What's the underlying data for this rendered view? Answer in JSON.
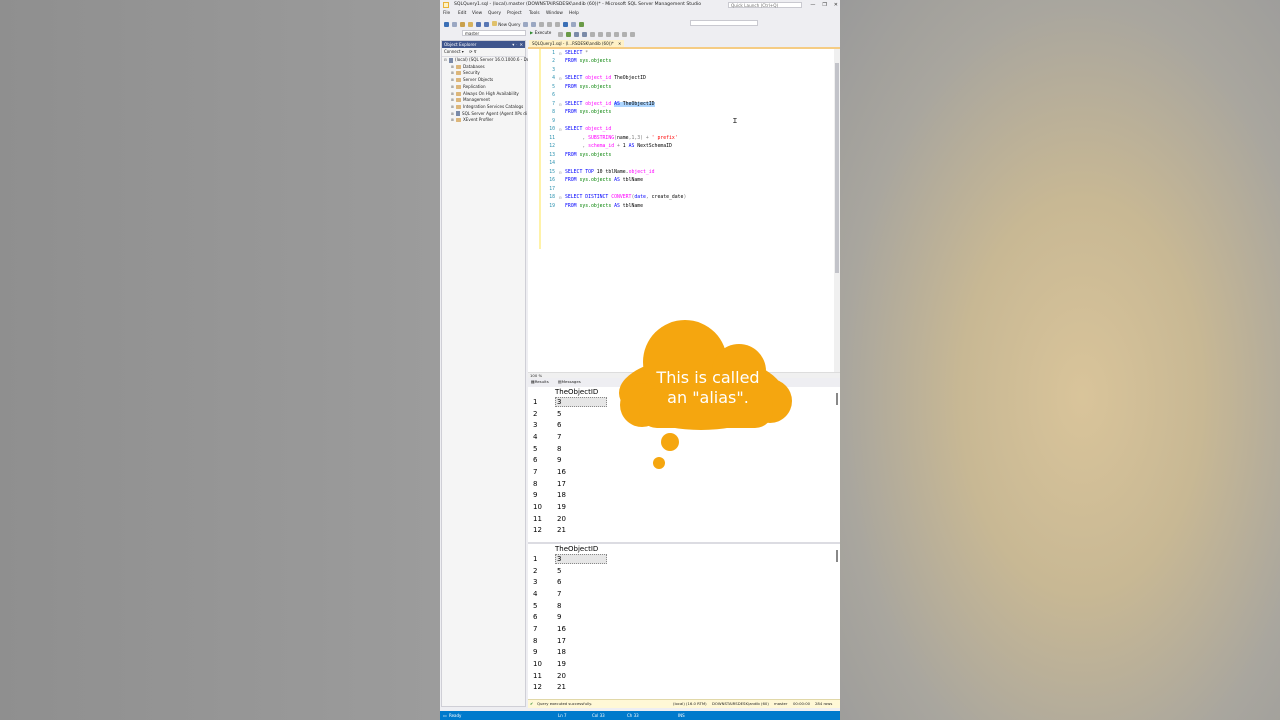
{
  "app": {
    "title": "SQLQuery1.sql - (local).master (DOWNSTAIRSDESK\\andib (60))* - Microsoft SQL Server Management Studio",
    "quick_launch_placeholder": "Quick Launch (Ctrl+Q)",
    "window_buttons": [
      "—",
      "❐",
      "✕"
    ]
  },
  "menu": [
    "File",
    "Edit",
    "View",
    "Query",
    "Project",
    "Tools",
    "Window",
    "Help"
  ],
  "toolbar": {
    "new_query": "New Query",
    "database": "master",
    "execute": "Execute"
  },
  "object_explorer": {
    "header": "Object Explorer",
    "pins": "▾ ᛫ ✕",
    "connect": "Connect ▾",
    "tree": [
      {
        "label": "(local) (SQL Server 16.0.1000.6 - Downsta",
        "type": "server",
        "expanded": true
      },
      {
        "label": "Databases",
        "type": "folder"
      },
      {
        "label": "Security",
        "type": "folder"
      },
      {
        "label": "Server Objects",
        "type": "folder"
      },
      {
        "label": "Replication",
        "type": "folder"
      },
      {
        "label": "Always On High Availability",
        "type": "folder"
      },
      {
        "label": "Management",
        "type": "folder"
      },
      {
        "label": "Integration Services Catalogs",
        "type": "folder"
      },
      {
        "label": "SQL Server Agent (Agent XPs di",
        "type": "agent"
      },
      {
        "label": "XEvent Profiler",
        "type": "folder"
      }
    ]
  },
  "editor": {
    "tab_label": "SQLQuery1.sql - (l...RSDESK\\andib (60))*",
    "tab_close": "✕",
    "zoom": "100 %",
    "lines": [
      {
        "n": "1",
        "fold": "⊟",
        "parts": [
          {
            "c": "kw",
            "t": "SELECT "
          },
          {
            "c": "gray",
            "t": "*"
          }
        ]
      },
      {
        "n": "2",
        "fold": "",
        "parts": [
          {
            "c": "kw",
            "t": "FROM "
          },
          {
            "c": "obj",
            "t": "sys.objects"
          }
        ]
      },
      {
        "n": "3",
        "fold": "",
        "parts": []
      },
      {
        "n": "4",
        "fold": "⊟",
        "parts": [
          {
            "c": "kw",
            "t": "SELECT "
          },
          {
            "c": "col",
            "t": "object_id"
          },
          {
            "c": "plain",
            "t": " TheObjectID"
          }
        ]
      },
      {
        "n": "5",
        "fold": "",
        "parts": [
          {
            "c": "kw",
            "t": "FROM "
          },
          {
            "c": "obj",
            "t": "sys.objects"
          }
        ]
      },
      {
        "n": "6",
        "fold": "",
        "parts": []
      },
      {
        "n": "7",
        "fold": "⊟",
        "parts": [
          {
            "c": "kw",
            "t": "SELECT "
          },
          {
            "c": "col",
            "t": "object_id"
          },
          {
            "c": "plain",
            "t": " "
          },
          {
            "c": "kw sel",
            "t": "AS"
          },
          {
            "c": "plain sel",
            "t": " TheObjectID"
          }
        ]
      },
      {
        "n": "8",
        "fold": "",
        "parts": [
          {
            "c": "kw",
            "t": "FROM "
          },
          {
            "c": "obj",
            "t": "sys.objects"
          }
        ]
      },
      {
        "n": "9",
        "fold": "",
        "parts": []
      },
      {
        "n": "10",
        "fold": "⊟",
        "parts": [
          {
            "c": "kw",
            "t": "SELECT "
          },
          {
            "c": "col",
            "t": "object_id"
          }
        ]
      },
      {
        "n": "11",
        "fold": "",
        "parts": [
          {
            "c": "gray",
            "t": "      , "
          },
          {
            "c": "fn",
            "t": "SUBSTRING"
          },
          {
            "c": "gray",
            "t": "("
          },
          {
            "c": "plain",
            "t": "name"
          },
          {
            "c": "gray",
            "t": ",1,3) + "
          },
          {
            "c": "str",
            "t": "' prefix'"
          }
        ]
      },
      {
        "n": "12",
        "fold": "",
        "parts": [
          {
            "c": "gray",
            "t": "      , "
          },
          {
            "c": "col",
            "t": "schema_id"
          },
          {
            "c": "gray",
            "t": " + "
          },
          {
            "c": "plain",
            "t": "1 "
          },
          {
            "c": "kw",
            "t": "AS"
          },
          {
            "c": "plain",
            "t": " NextSchemaID"
          }
        ]
      },
      {
        "n": "13",
        "fold": "",
        "parts": [
          {
            "c": "kw",
            "t": "FROM "
          },
          {
            "c": "obj",
            "t": "sys.objects"
          }
        ]
      },
      {
        "n": "14",
        "fold": "",
        "parts": []
      },
      {
        "n": "15",
        "fold": "⊟",
        "parts": [
          {
            "c": "kw",
            "t": "SELECT TOP "
          },
          {
            "c": "plain",
            "t": "10 tblName."
          },
          {
            "c": "col",
            "t": "object_id"
          }
        ]
      },
      {
        "n": "16",
        "fold": "",
        "parts": [
          {
            "c": "kw",
            "t": "FROM "
          },
          {
            "c": "obj",
            "t": "sys.objects"
          },
          {
            "c": "plain",
            "t": " "
          },
          {
            "c": "kw",
            "t": "AS"
          },
          {
            "c": "plain",
            "t": " tblName"
          }
        ]
      },
      {
        "n": "17",
        "fold": "",
        "parts": []
      },
      {
        "n": "18",
        "fold": "⊟",
        "parts": [
          {
            "c": "kw",
            "t": "SELECT DISTINCT "
          },
          {
            "c": "fn",
            "t": "CONVERT"
          },
          {
            "c": "gray",
            "t": "("
          },
          {
            "c": "kw",
            "t": "date"
          },
          {
            "c": "gray",
            "t": ", "
          },
          {
            "c": "plain",
            "t": "create_date"
          },
          {
            "c": "gray",
            "t": ")"
          }
        ]
      },
      {
        "n": "19",
        "fold": "",
        "parts": [
          {
            "c": "kw",
            "t": "FROM "
          },
          {
            "c": "obj",
            "t": "sys.objects"
          },
          {
            "c": "plain",
            "t": " "
          },
          {
            "c": "kw",
            "t": "AS"
          },
          {
            "c": "plain",
            "t": " tblName"
          }
        ]
      }
    ]
  },
  "results": {
    "tab_results": "Results",
    "tab_messages": "Messages",
    "grids": [
      {
        "column": "TheObjectID",
        "rows": [
          [
            "1",
            "3"
          ],
          [
            "2",
            "5"
          ],
          [
            "3",
            "6"
          ],
          [
            "4",
            "7"
          ],
          [
            "5",
            "8"
          ],
          [
            "6",
            "9"
          ],
          [
            "7",
            "16"
          ],
          [
            "8",
            "17"
          ],
          [
            "9",
            "18"
          ],
          [
            "10",
            "19"
          ],
          [
            "11",
            "20"
          ],
          [
            "12",
            "21"
          ]
        ]
      },
      {
        "column": "TheObjectID",
        "rows": [
          [
            "1",
            "3"
          ],
          [
            "2",
            "5"
          ],
          [
            "3",
            "6"
          ],
          [
            "4",
            "7"
          ],
          [
            "5",
            "8"
          ],
          [
            "6",
            "9"
          ],
          [
            "7",
            "16"
          ],
          [
            "8",
            "17"
          ],
          [
            "9",
            "18"
          ],
          [
            "10",
            "19"
          ],
          [
            "11",
            "20"
          ],
          [
            "12",
            "21"
          ]
        ]
      }
    ]
  },
  "query_status": {
    "message": "Query executed successfully.",
    "server": "(local) (16.0 RTM)",
    "login": "DOWNSTAIRSDESK\\andib (60)",
    "database": "master",
    "elapsed": "00:00:00",
    "rows": "284 rows"
  },
  "statusbar": {
    "ready": "Ready",
    "ln": "Ln 7",
    "col": "Col 33",
    "ch": "Ch 33",
    "ins": "INS"
  },
  "overlay": {
    "line1": "This is called",
    "line2": "an \"alias\".",
    "color": "#f5a60f"
  }
}
